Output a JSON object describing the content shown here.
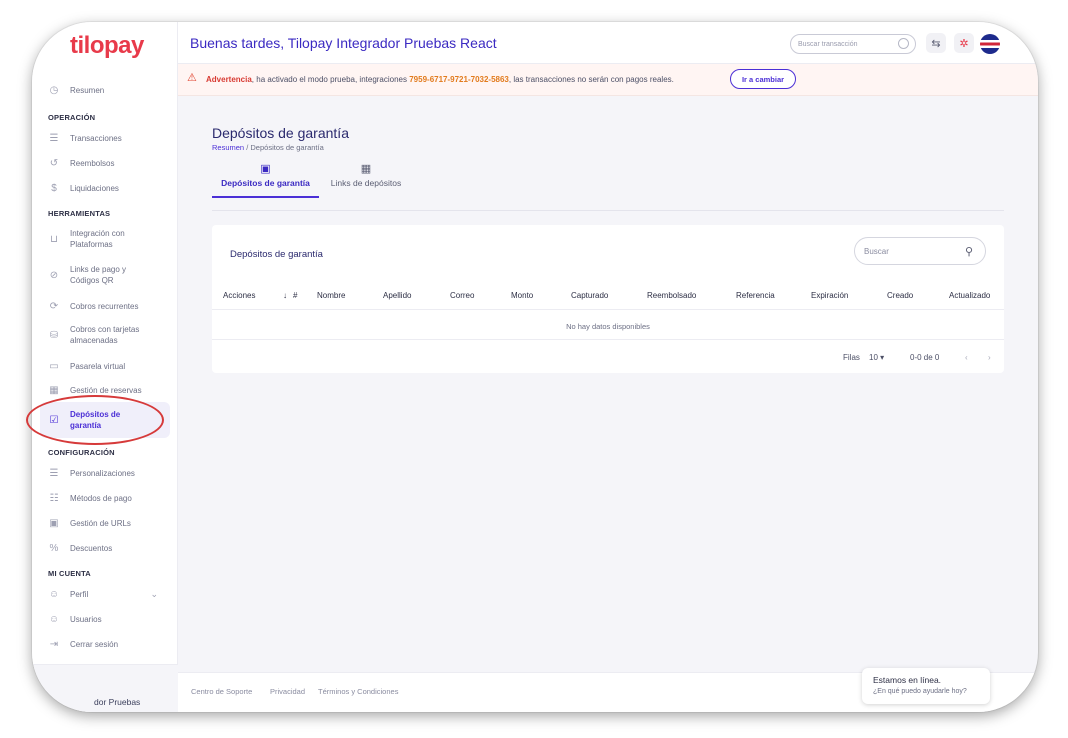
{
  "app": {
    "logo_text_a": "ti",
    "logo_text_b": "lopay"
  },
  "header": {
    "greeting": "Buenas tardes, Tilopay Integrador Pruebas React",
    "search_placeholder": "Buscar transacción"
  },
  "warning": {
    "label": "Advertencia",
    "text_1": ", ha activado el modo prueba, integraciones ",
    "code": "7959-6717-9721-7032-5863",
    "text_2": ", las transacciones no serán con pagos reales.",
    "button": "Ir a cambiar"
  },
  "sidebar": {
    "resumen": "Resumen",
    "sec_operacion": "OPERACIÓN",
    "transacciones": "Transacciones",
    "reembolsos": "Reembolsos",
    "liquidaciones": "Liquidaciones",
    "sec_herramientas": "HERRAMIENTAS",
    "integracion": "Integración con Plataformas",
    "links": "Links de pago y Códigos QR",
    "cobros_rec": "Cobros recurrentes",
    "cobros_tar": "Cobros con tarjetas almacenadas",
    "pasarela": "Pasarela virtual",
    "reservas": "Gestión de reservas",
    "depositos": "Depósitos de garantía",
    "sec_config": "CONFIGURACIÓN",
    "personalizaciones": "Personalizaciones",
    "metodos": "Métodos de pago",
    "urls": "Gestión de URLs",
    "descuentos": "Descuentos",
    "sec_cuenta": "MI CUENTA",
    "perfil": "Perfil",
    "usuarios": "Usuarios",
    "cerrar": "Cerrar sesión",
    "footer_user": "dor Pruebas"
  },
  "page": {
    "title": "Depósitos de garantía",
    "breadcrumb_home": "Resumen",
    "breadcrumb_sep": "/",
    "breadcrumb_current": "Depósitos de garantía",
    "tabs": [
      {
        "label": "Depósitos de garantía",
        "icon": "wallet-icon"
      },
      {
        "label": "Links de depósitos",
        "icon": "qr-icon"
      }
    ]
  },
  "table": {
    "card_title": "Depósitos de garantía",
    "search_placeholder": "Buscar",
    "columns": [
      "Acciones",
      "#",
      "Nombre",
      "Apellido",
      "Correo",
      "Monto",
      "Capturado",
      "Reembolsado",
      "Referencia",
      "Expiración",
      "Creado",
      "Actualizado"
    ],
    "empty": "No hay datos disponibles",
    "rows_label": "Filas",
    "rows_value": "10",
    "range": "0-0 de 0"
  },
  "footer": {
    "support": "Centro de Soporte",
    "privacy": "Privacidad",
    "terms": "Términos y Condiciones"
  },
  "chat": {
    "title": "Estamos en línea.",
    "subtitle": "¿En qué puedo ayudarle hoy?"
  },
  "colors": {
    "accent": "#4b2fd6",
    "brand_red": "#e83a4a",
    "warning": "#d83b33"
  }
}
